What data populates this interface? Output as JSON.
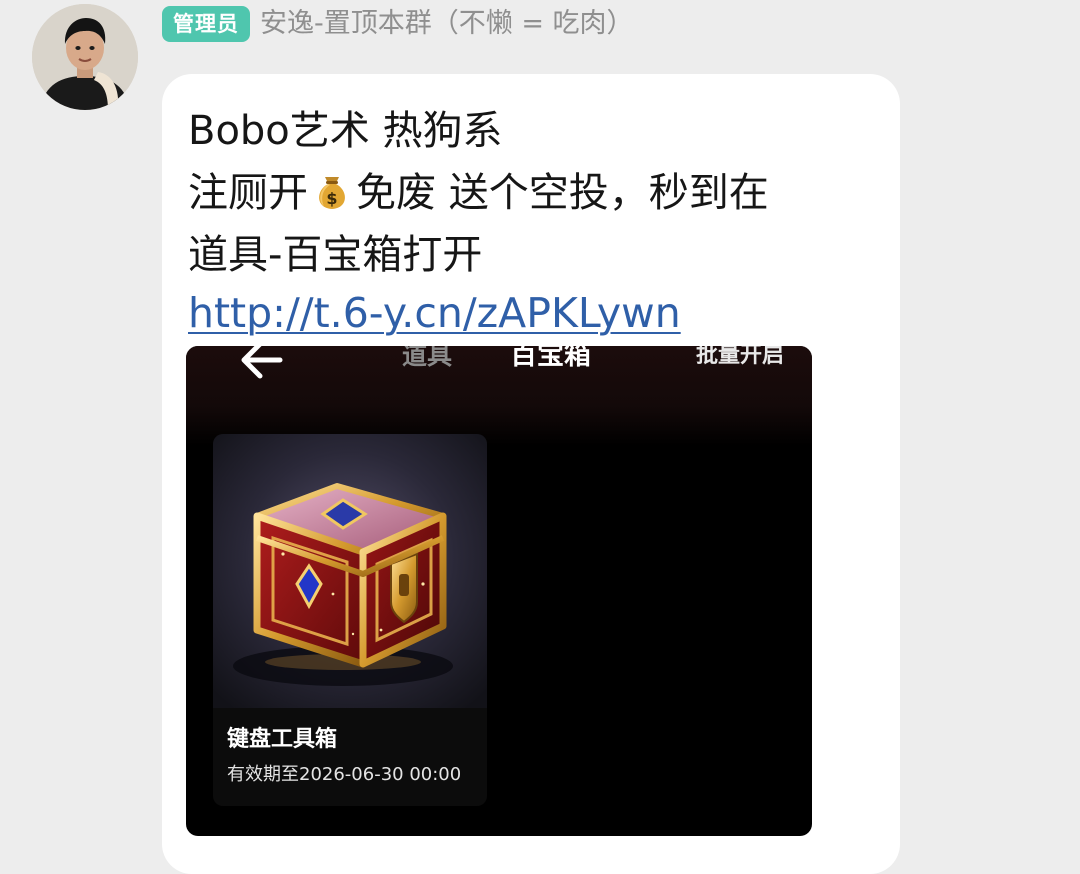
{
  "sender": {
    "badge": "管理员",
    "name": "安逸-置顶本群（不懒 = 吃肉）"
  },
  "message": {
    "line1": "Bobo艺术 热狗系",
    "line2_before": "注厕开",
    "line2_emoji": "money-bag-emoji",
    "line2_after": "免废 送个空投，秒到在",
    "line3": "道具-百宝箱打开",
    "link": "http://t.6-y.cn/zAPKLywn"
  },
  "screenshot": {
    "tab_props": "道具",
    "tab_treasure": "百宝箱",
    "batch_open": "批量开启",
    "item": {
      "title": "键盘工具箱",
      "expiry": "有效期至2026-06-30 00:00"
    }
  },
  "colors": {
    "background": "#ededed",
    "bubble": "#ffffff",
    "badge": "#4fc6ae",
    "link": "#2f5fa8",
    "sender_name": "#8f8f8f"
  }
}
